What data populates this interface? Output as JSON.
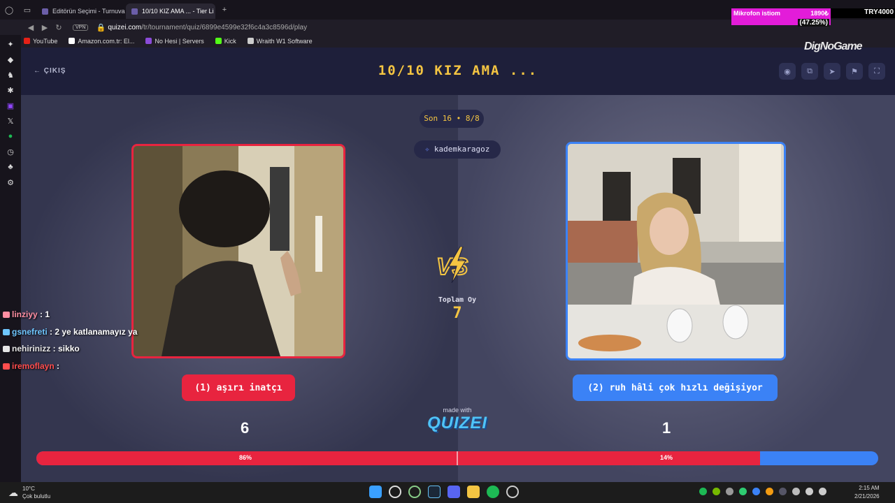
{
  "browser": {
    "tabs": [
      {
        "label": "Editörün Seçimi - Turnuva"
      },
      {
        "label": "10/10 KIZ AMA ... - Tier Li"
      }
    ],
    "vpn": "VPN",
    "url_host": "quizei.com",
    "url_path": "/tr/tournament/quiz/6899e4599e32f6c4a3c8596d/play",
    "bookmarks": [
      "YouTube",
      "Amazon.com.tr: El...",
      "No Hesi | Servers",
      "Kick",
      "Wraith W1 Software"
    ]
  },
  "app": {
    "exit_label": "ÇIKIŞ",
    "title": "10/10 KIZ AMA ...",
    "round_label": "Son 16 • 8/8",
    "creator": "kademkaragoz",
    "total_votes_label": "Toplam Oy",
    "total_votes": "7",
    "left_option": "(1) aşırı inatçı",
    "right_option": "(2) ruh hâli çok hızlı değişiyor",
    "left_count": "6",
    "right_count": "1",
    "left_pct_label": "86%",
    "right_pct_label": "14%",
    "left_share": 0.86,
    "made_with": "made with",
    "logo_text": "QUIZEI"
  },
  "overlay": {
    "chat": [
      {
        "user": "linziyy",
        "msg": " : 1",
        "color": "#ff8fa3"
      },
      {
        "user": "gsnefreti",
        "msg": " : 2 ye katlanamayız ya",
        "color": "#6ec6ff"
      },
      {
        "user": "nehirinizz",
        "msg": " : sikko",
        "color": "#e6e6e6"
      },
      {
        "user": "iremoflayn",
        "msg": " : ",
        "color": "#ff4d4d"
      }
    ],
    "mic_label": "Mikrofon istiom",
    "mic_value": "1890₺",
    "mic_pct": "(47.25%)",
    "try_label": "TRY4000",
    "brand": "DigNoGame"
  },
  "taskbar": {
    "temp": "10°C",
    "weather": "Çok bulutlu",
    "time": "2:15 AM",
    "date": "2/21/2026"
  },
  "colors": {
    "red": "#e8243f",
    "blue": "#3b82f6",
    "gold": "#f5c542"
  }
}
